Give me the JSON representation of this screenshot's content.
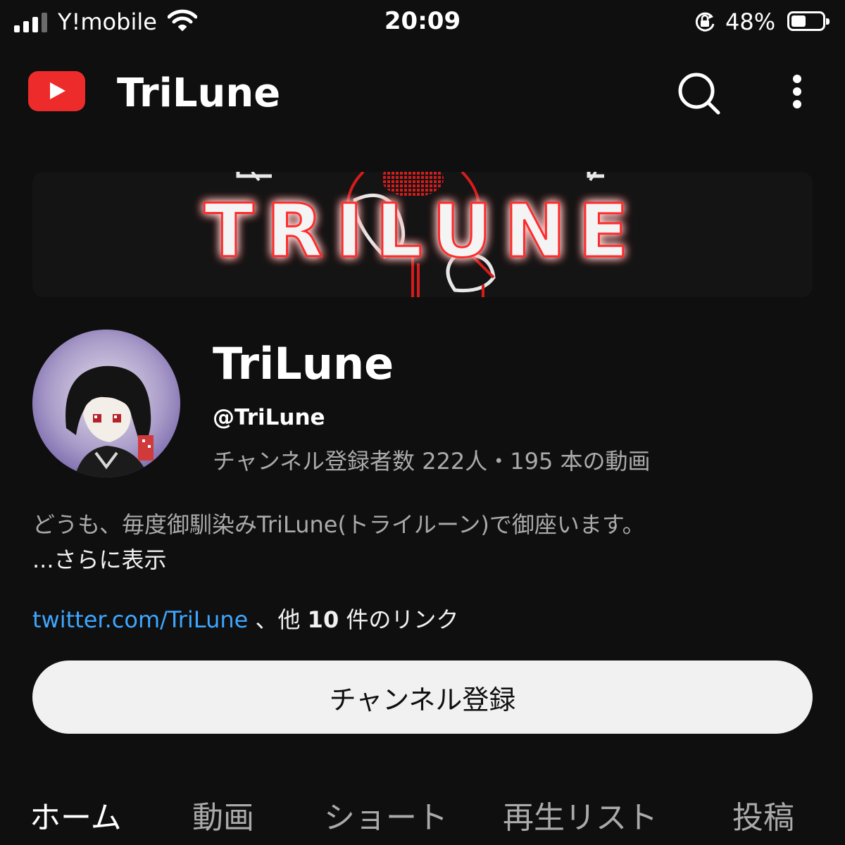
{
  "status_bar": {
    "carrier": "Y!mobile",
    "time": "20:09",
    "battery_percent": "48%",
    "battery_level": 0.48,
    "signal_bars_active": 3,
    "signal_bars_total": 4
  },
  "app_bar": {
    "title": "TriLune",
    "logo_icon": "youtube-logo",
    "search_icon": "search-icon",
    "more_icon": "more-vertical-icon"
  },
  "banner": {
    "text": "TRILUNE",
    "glow_color": "#e02020"
  },
  "channel": {
    "name": "TriLune",
    "handle": "@TriLune",
    "stats": "チャンネル登録者数 222人・195 本の動画",
    "description": "どうも、毎度御馴染みTriLune(トライルーン)で御座います。",
    "more_label": "...さらに表示",
    "link_url": "twitter.com/TriLune",
    "link_sep": " 、他 ",
    "link_count": "10",
    "link_suffix": " 件のリンク",
    "subscribe_label": "チャンネル登録"
  },
  "tabs": [
    {
      "label": "ホーム",
      "active": true
    },
    {
      "label": "動画",
      "active": false
    },
    {
      "label": "ショート",
      "active": false
    },
    {
      "label": "再生リスト",
      "active": false
    },
    {
      "label": "投稿",
      "active": false
    }
  ],
  "colors": {
    "background": "#0f0f0f",
    "youtube_red": "#ee2b2b",
    "link_blue": "#3ea6ff",
    "secondary_text": "#aaaaaa"
  }
}
